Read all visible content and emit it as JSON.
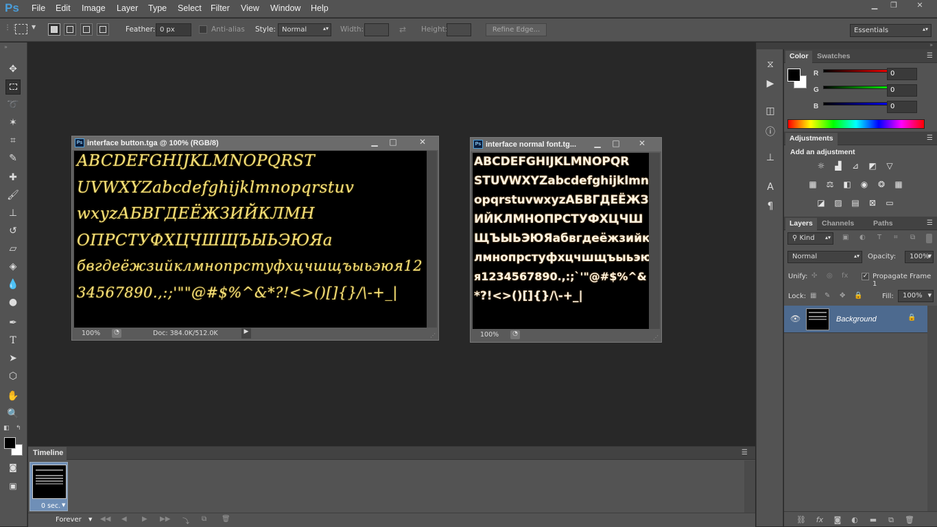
{
  "app": {
    "logo": "Ps"
  },
  "menu": [
    "File",
    "Edit",
    "Image",
    "Layer",
    "Type",
    "Select",
    "Filter",
    "View",
    "Window",
    "Help"
  ],
  "window_controls": {
    "minimize": "▁",
    "restore": "❐",
    "close": "✕"
  },
  "options": {
    "feather_label": "Feather:",
    "feather_value": "0 px",
    "antialias_label": "Anti-alias",
    "style_label": "Style:",
    "style_value": "Normal",
    "width_label": "Width:",
    "height_label": "Height:",
    "refine_edge": "Refine Edge...",
    "workspace": "Essentials"
  },
  "doc1": {
    "title": "interface button.tga @ 100% (RGB/8)",
    "lines": [
      "ABCDEFGHIJKLMNOPQRST",
      "UVWXYZabcdefghijklmnopqrstuv",
      "wxyzАБВГДЕЁЖЗИЙКЛМН",
      "ОПРСТУФХЦЧШЩЪЫЬЭЮЯа",
      "бвгдеёжзийклмнопрстуфхцчшщъыьэюя12",
      "34567890.,:;'\"\"@#$%^&*?!<>()[]{}/\\-+_|"
    ],
    "zoom": "100%",
    "doc_info": "Doc: 384.0K/512.0K"
  },
  "doc2": {
    "title": "interface normal font.tg...",
    "lines": [
      "ABCDEFGHIJKLMNOPQR",
      "STUVWXYZabcdefghijklmn",
      "opqrstuvwxyzАБВГДЕЁЖЗ",
      "ИЙКЛМНОПРСТУФХЦЧШ",
      "ЩЪЫЬЭЮЯабвгдеёжзийк",
      "лмнопрстуфхцчшщъыьэю",
      "я1234567890.,:;`'\"@#$%^&",
      "*?!<>()[]{}/\\-+_|"
    ],
    "zoom": "100%"
  },
  "timeline": {
    "title": "Timeline",
    "frame_number": "1",
    "frame_delay": "0 sec.",
    "loop": "Forever"
  },
  "color_panel": {
    "tabs": [
      "Color",
      "Swatches"
    ],
    "channels": [
      {
        "label": "R",
        "value": "0"
      },
      {
        "label": "G",
        "value": "0"
      },
      {
        "label": "B",
        "value": "0"
      }
    ]
  },
  "adjustments": {
    "title": "Adjustments",
    "subtitle": "Add an adjustment"
  },
  "layers_panel": {
    "tabs": [
      "Layers",
      "Channels",
      "Paths"
    ],
    "kind": "Kind",
    "blend_mode": "Normal",
    "opacity_label": "Opacity:",
    "opacity_value": "100%",
    "unify_label": "Unify:",
    "propagate_label": "Propagate Frame 1",
    "lock_label": "Lock:",
    "fill_label": "Fill:",
    "fill_value": "100%",
    "layer_name": "Background"
  },
  "colors": {
    "accent": "#4a9eda",
    "panel": "#535353",
    "canvas": "#282828",
    "script_text": "#f6e27a"
  }
}
